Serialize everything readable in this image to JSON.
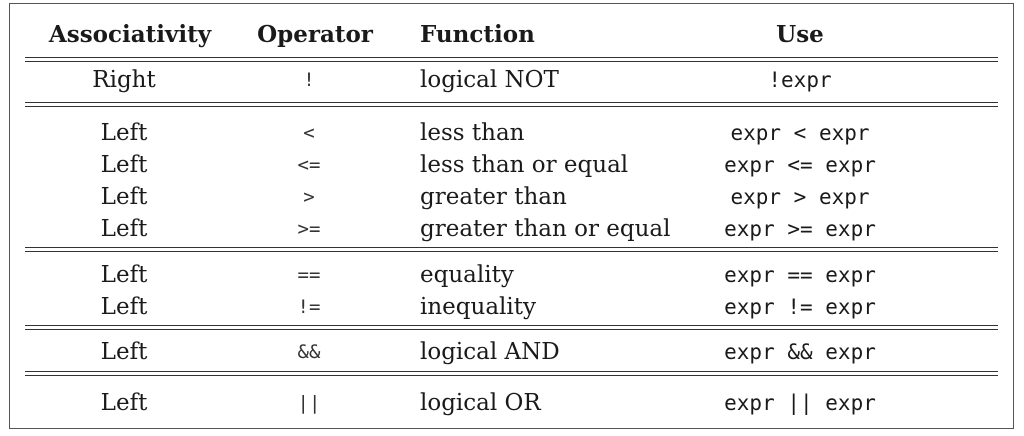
{
  "header": {
    "associativity": "Associativity",
    "operator": "Operator",
    "function": "Function",
    "use": "Use"
  },
  "rows": [
    {
      "assoc": "Right",
      "op": "!",
      "fn": "logical NOT",
      "use": "!expr"
    },
    {
      "assoc": "Left",
      "op": "<",
      "fn": "less than",
      "use": "expr < expr"
    },
    {
      "assoc": "Left",
      "op": "<=",
      "fn": "less than or equal",
      "use": "expr <= expr"
    },
    {
      "assoc": "Left",
      "op": ">",
      "fn": "greater than",
      "use": "expr > expr"
    },
    {
      "assoc": "Left",
      "op": ">=",
      "fn": "greater than or equal",
      "use": "expr >= expr"
    },
    {
      "assoc": "Left",
      "op": "==",
      "fn": "equality",
      "use": "expr == expr"
    },
    {
      "assoc": "Left",
      "op": "!=",
      "fn": "inequality",
      "use": "expr != expr"
    },
    {
      "assoc": "Left",
      "op": "&&",
      "fn": "logical AND",
      "use": "expr && expr"
    },
    {
      "assoc": "Left",
      "op": "||",
      "fn": "logical OR",
      "use": "expr || expr"
    }
  ]
}
